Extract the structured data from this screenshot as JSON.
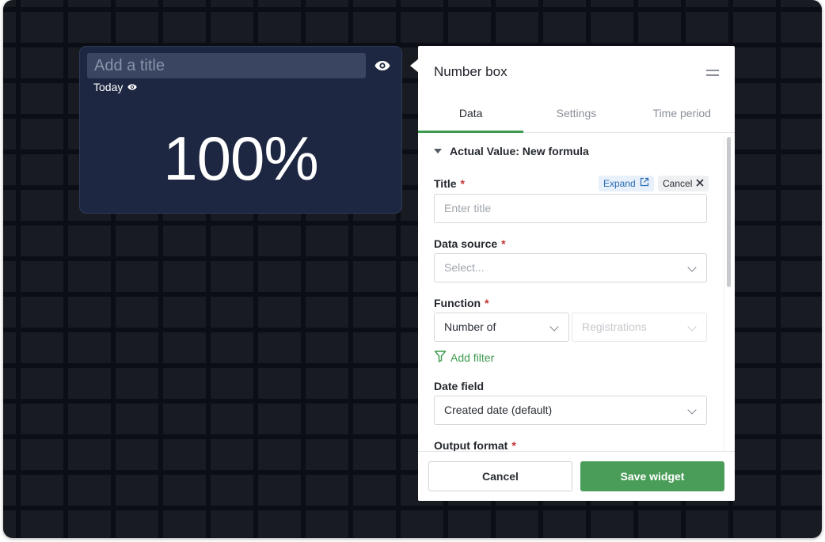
{
  "widget": {
    "title_placeholder": "Add a title",
    "period": "Today",
    "value": "100%"
  },
  "panel": {
    "title": "Number box",
    "tabs": [
      {
        "label": "Data",
        "active": true
      },
      {
        "label": "Settings",
        "active": false
      },
      {
        "label": "Time period",
        "active": false
      }
    ],
    "section_title": "Actual Value: New formula",
    "title_field": {
      "label": "Title",
      "required_mark": "*",
      "placeholder": "Enter title",
      "expand_label": "Expand",
      "cancel_label": "Cancel"
    },
    "data_source": {
      "label": "Data source",
      "required_mark": "*",
      "placeholder": "Select..."
    },
    "function": {
      "label": "Function",
      "required_mark": "*",
      "value": "Number of",
      "secondary_placeholder": "Registrations"
    },
    "add_filter": "Add filter",
    "date_field": {
      "label": "Date field",
      "value": "Created date (default)"
    },
    "output_format": {
      "label": "Output format",
      "required_mark": "*"
    },
    "footer": {
      "cancel_label": "Cancel",
      "save_label": "Save widget"
    }
  },
  "colors": {
    "accent_green": "#4a9d59",
    "link_blue": "#2b6cb0",
    "required_red": "#c53030",
    "widget_bg": "#1e2741"
  }
}
